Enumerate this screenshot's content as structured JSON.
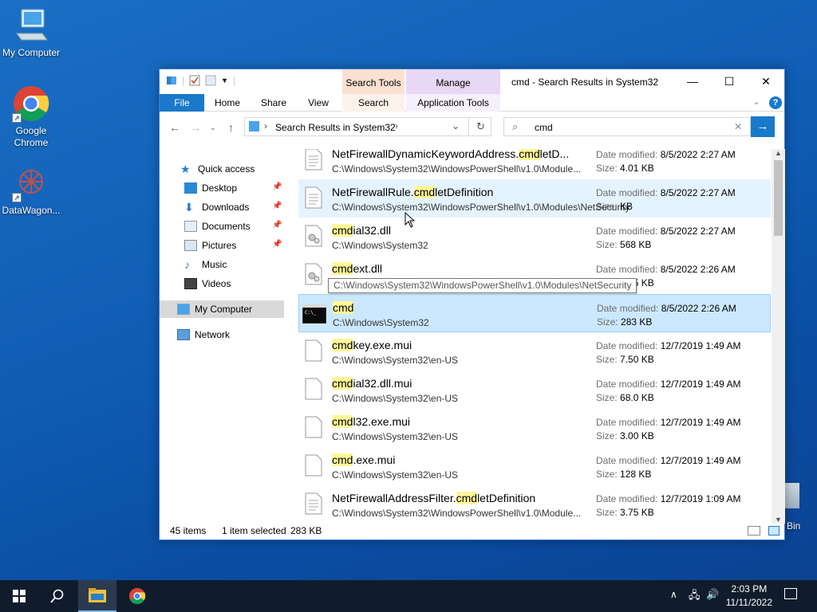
{
  "desktop": {
    "icons": [
      {
        "label": "My Computer"
      },
      {
        "label": "Google Chrome"
      },
      {
        "label": "DataWagon..."
      },
      {
        "label": "Bin"
      }
    ]
  },
  "window": {
    "title": "cmd - Search Results in System32",
    "context_tabs": [
      {
        "group": "Search Tools",
        "tab": "Search",
        "color": "#fbe1cf"
      },
      {
        "group": "Manage",
        "tab": "Application Tools",
        "color": "#e8d7f5"
      }
    ],
    "ribbon_tabs": [
      "File",
      "Home",
      "Share",
      "View"
    ],
    "address": "Search Results in System32",
    "search_value": "cmd",
    "sidebar": [
      {
        "label": "Quick access",
        "icon": "star-icon"
      },
      {
        "label": "Desktop",
        "icon": "desktop-folder-icon",
        "pinned": true
      },
      {
        "label": "Downloads",
        "icon": "download-icon",
        "pinned": true
      },
      {
        "label": "Documents",
        "icon": "documents-icon",
        "pinned": true
      },
      {
        "label": "Pictures",
        "icon": "pictures-icon",
        "pinned": true
      },
      {
        "label": "Music",
        "icon": "music-icon"
      },
      {
        "label": "Videos",
        "icon": "videos-icon"
      },
      {
        "label": "My Computer",
        "icon": "computer-icon",
        "selected": true
      },
      {
        "label": "Network",
        "icon": "network-icon"
      }
    ],
    "files": [
      {
        "pre": "NetFirewallDynamicKeywordAddress.",
        "hl": "cmd",
        "post": "letD...",
        "path": "C:\\Windows\\System32\\WindowsPowerShell\\v1.0\\Module...",
        "date": "8/5/2022 2:27 AM",
        "size": "4.01 KB",
        "icon": "document-icon"
      },
      {
        "pre": "NetFirewallRule.",
        "hl": "cmd",
        "post": "letDefinition",
        "path": "C:\\Windows\\System32\\WindowsPowerShell\\v1.0\\Modules\\NetSecurity",
        "date": "8/5/2022 2:27 AM",
        "size": "KB",
        "icon": "document-icon",
        "state": "hover"
      },
      {
        "pre": "",
        "hl": "cmd",
        "post": "ial32.dll",
        "path": "C:\\Windows\\System32",
        "date": "8/5/2022 2:27 AM",
        "size": "568 KB",
        "icon": "dll-icon"
      },
      {
        "pre": "",
        "hl": "cmd",
        "post": "ext.dll",
        "path": "C:\\Windows\\System32",
        "date": "8/5/2022 2:26 AM",
        "size": "27.5 KB",
        "icon": "dll-icon"
      },
      {
        "pre": "",
        "hl": "cmd",
        "post": "",
        "path": "C:\\Windows\\System32",
        "date": "8/5/2022 2:26 AM",
        "size": "283 KB",
        "icon": "console-icon",
        "state": "selected"
      },
      {
        "pre": "",
        "hl": "cmd",
        "post": "key.exe.mui",
        "path": "C:\\Windows\\System32\\en-US",
        "date": "12/7/2019 1:49 AM",
        "size": "7.50 KB",
        "icon": "blank-file-icon"
      },
      {
        "pre": "",
        "hl": "cmd",
        "post": "ial32.dll.mui",
        "path": "C:\\Windows\\System32\\en-US",
        "date": "12/7/2019 1:49 AM",
        "size": "68.0 KB",
        "icon": "blank-file-icon"
      },
      {
        "pre": "",
        "hl": "cmd",
        "post": "l32.exe.mui",
        "path": "C:\\Windows\\System32\\en-US",
        "date": "12/7/2019 1:49 AM",
        "size": "3.00 KB",
        "icon": "blank-file-icon"
      },
      {
        "pre": "",
        "hl": "cmd",
        "post": ".exe.mui",
        "path": "C:\\Windows\\System32\\en-US",
        "date": "12/7/2019 1:49 AM",
        "size": "128 KB",
        "icon": "blank-file-icon"
      },
      {
        "pre": "NetFirewallAddressFilter.",
        "hl": "cmd",
        "post": "letDefinition",
        "path": "C:\\Windows\\System32\\WindowsPowerShell\\v1.0\\Module...",
        "date": "12/7/2019 1:09 AM",
        "size": "3.75 KB",
        "icon": "document-icon"
      }
    ],
    "labels": {
      "date_modified": "Date modified:",
      "size": "Size:"
    },
    "tooltip": "C:\\Windows\\System32\\WindowsPowerShell\\v1.0\\Modules\\NetSecurity",
    "status": {
      "count": "45 items",
      "selection": "1 item selected",
      "size": "283 KB"
    }
  },
  "taskbar": {
    "time": "2:03 PM",
    "date": "11/11/2022",
    "background": "#101c2c"
  }
}
